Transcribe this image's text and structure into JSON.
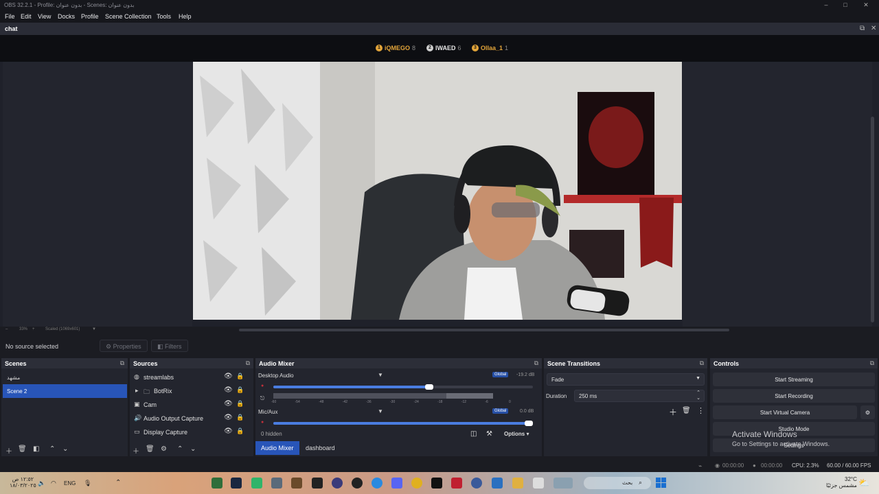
{
  "window": {
    "title": "OBS 32.2.1 - Profile: بدون عنوان - Scenes: بدون عنوان"
  },
  "menu": [
    "File",
    "Edit",
    "View",
    "Docks",
    "Profile",
    "Scene Collection",
    "Tools",
    "Help"
  ],
  "chat_dock": {
    "title": "chat",
    "chatters": [
      {
        "name": "iQMEGO",
        "count": "8",
        "color": "#e3a53a"
      },
      {
        "name": "IWAED",
        "count": "6",
        "color": "#d0d0d0"
      },
      {
        "name": "Ollaa_1",
        "count": "1",
        "color": "#e3a53a"
      }
    ]
  },
  "preview": {
    "zoom_left": "33%",
    "zoom_mid": "Scaled (1069x601)"
  },
  "source_bar": {
    "no_source": "No source selected",
    "properties": "Properties",
    "filters": "Filters"
  },
  "scenes": {
    "title": "Scenes",
    "items": [
      {
        "label": "مشهد",
        "selected": false
      },
      {
        "label": "Scene 2",
        "selected": true
      }
    ]
  },
  "sources": {
    "title": "Sources",
    "items": [
      {
        "label": "streamlabs",
        "icon": "globe-icon"
      },
      {
        "label": "BotRix",
        "icon": "folder-icon"
      },
      {
        "label": "Cam",
        "icon": "camera-icon"
      },
      {
        "label": "Audio Output Capture",
        "icon": "speaker-icon"
      },
      {
        "label": "Display Capture",
        "icon": "monitor-icon"
      }
    ]
  },
  "audio_mixer": {
    "title": "Audio Mixer",
    "channels": [
      {
        "name": "Desktop Audio",
        "tag": "Global",
        "db": "-19.2 dB",
        "level": 0.6
      },
      {
        "name": "Mic/Aux",
        "tag": "Global",
        "db": "0.0 dB",
        "level": 1.0
      }
    ],
    "ticks": [
      "-60",
      "-54",
      "-48",
      "-42",
      "-36",
      "-30",
      "-24",
      "-18",
      "-12",
      "-6",
      "0"
    ],
    "hidden": "0 hidden",
    "options": "Options",
    "tabs": [
      "Audio Mixer",
      "dashboard"
    ]
  },
  "transitions": {
    "title": "Scene Transitions",
    "selected": "Fade",
    "duration_label": "Duration",
    "duration_value": "250 ms"
  },
  "controls": {
    "title": "Controls",
    "buttons": [
      "Start Streaming",
      "Start Recording",
      "Start Virtual Camera",
      "Studio Mode",
      "Settings"
    ]
  },
  "activate": {
    "line1": "Activate Windows",
    "line2": "Go to Settings to activate Windows."
  },
  "status": {
    "stream_time": "00:00:00",
    "rec_time": "00:00:00",
    "cpu": "CPU: 2.3%",
    "fps": "60.00 / 60.00 FPS"
  },
  "taskbar": {
    "lang": "ENG",
    "search": "بحث",
    "weather_temp": "32°C",
    "weather_desc": "مشمس جزئيًا",
    "clock_time": "١٢:٥٢ ص",
    "clock_date": "١٨/٠٣/٢٠٢٥"
  }
}
